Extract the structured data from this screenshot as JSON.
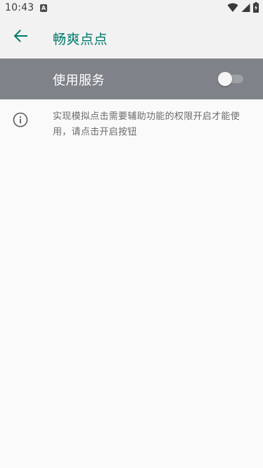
{
  "status_bar": {
    "time": "10:43",
    "notification_icon_letter": "A",
    "icons": [
      "notification-a-icon",
      "wifi-icon",
      "signal-icon",
      "battery-charging-icon"
    ]
  },
  "app_bar": {
    "title": "畅爽点点",
    "back_icon": "arrow-back-icon",
    "accent_color": "#00796b"
  },
  "service": {
    "label": "使用服务",
    "toggle_on": false,
    "bar_color": "#7f8389"
  },
  "info": {
    "icon": "info-icon",
    "text": "实现模拟点击需要辅助功能的权限开启才能使用，请点击开启按钮"
  }
}
